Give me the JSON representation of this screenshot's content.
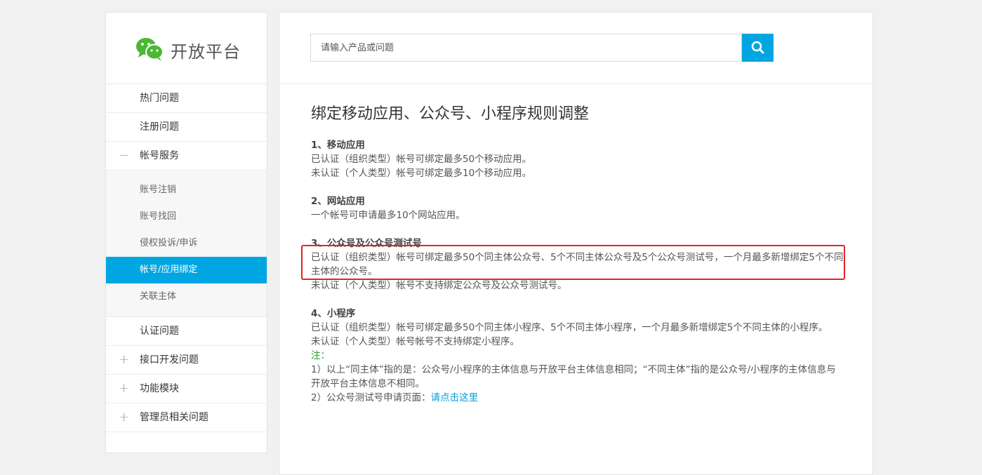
{
  "logo": {
    "text": "开放平台",
    "icon": "wechat-logo-icon",
    "color": "#4bb834"
  },
  "sidebar": {
    "items": [
      {
        "label": "热门问题",
        "toggle": ""
      },
      {
        "label": "注册问题",
        "toggle": ""
      },
      {
        "label": "帐号服务",
        "toggle": "−"
      }
    ],
    "sub_items": [
      {
        "label": "账号注销"
      },
      {
        "label": "账号找回"
      },
      {
        "label": "侵权投诉/申诉"
      },
      {
        "label": "帐号/应用绑定"
      },
      {
        "label": "关联主体"
      }
    ],
    "items_after": [
      {
        "label": "认证问题",
        "toggle": ""
      },
      {
        "label": "接口开发问题",
        "toggle": "+"
      },
      {
        "label": "功能模块",
        "toggle": "+"
      },
      {
        "label": "管理员相关问题",
        "toggle": "+"
      }
    ],
    "active_sub": "帐号/应用绑定",
    "accent": "#00a6e2"
  },
  "search": {
    "placeholder": "请输入产品或问题",
    "icon": "search-icon"
  },
  "article": {
    "title": "绑定移动应用、公众号、小程序规则调整",
    "sections": [
      {
        "head": "1、移动应用",
        "lines": [
          "已认证（组织类型）帐号可绑定最多50个移动应用。",
          "未认证（个人类型）帐号可绑定最多10个移动应用。"
        ]
      },
      {
        "head": "2、网站应用",
        "lines": [
          "一个帐号可申请最多10个网站应用。"
        ]
      },
      {
        "head": "3、公众号及公众号测试号",
        "lines": [
          "已认证（组织类型）帐号可绑定最多50个同主体公众号、5个不同主体公众号及5个公众号测试号，一个月最多新增绑定5个不同主体的公众号。",
          "未认证（个人类型）帐号不支持绑定公众号及公众号测试号。"
        ]
      },
      {
        "head": "4、小程序",
        "lines": [
          "已认证（组织类型）帐号可绑定最多50个同主体小程序、5个不同主体小程序，一个月最多新增绑定5个不同主体的小程序。",
          "未认证（个人类型）帐号帐号不支持绑定小程序。"
        ]
      }
    ],
    "note_label": "注：",
    "note1": "1）以上“同主体”指的是：公众号/小程序的主体信息与开放平台主体信息相同；“不同主体”指的是公众号/小程序的主体信息与开放平台主体信息不相同。",
    "note2_prefix": "2）公众号测试号申请页面：",
    "note2_link": "请点击这里"
  }
}
